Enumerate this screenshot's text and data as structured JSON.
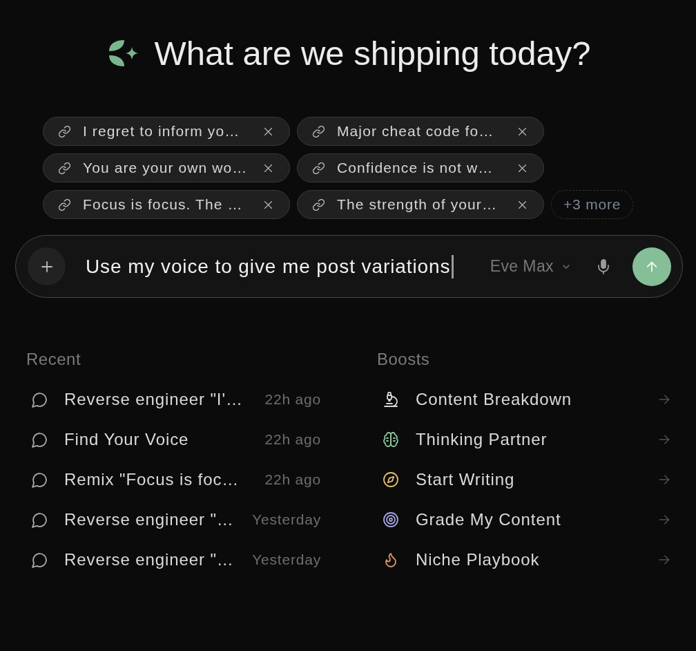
{
  "header": {
    "title": "What are we shipping today?"
  },
  "attachments": {
    "items": [
      {
        "label": "I regret to inform yo…"
      },
      {
        "label": "Major cheat code fo…"
      },
      {
        "label": "You are your own wo…"
      },
      {
        "label": "Confidence is not w…"
      },
      {
        "label": "Focus is focus. The …"
      },
      {
        "label": "The strength of your…"
      }
    ],
    "more": "+3 more"
  },
  "composer": {
    "value": "Use my voice to give me post variations",
    "model": "Eve Max"
  },
  "recent": {
    "heading": "Recent",
    "items": [
      {
        "title": "Reverse engineer \"I'…",
        "time": "22h ago"
      },
      {
        "title": "Find Your Voice",
        "time": "22h ago"
      },
      {
        "title": "Remix \"Focus is foc…",
        "time": "22h ago"
      },
      {
        "title": "Reverse engineer \"…",
        "time": "Yesterday"
      },
      {
        "title": "Reverse engineer \"…",
        "time": "Yesterday"
      }
    ]
  },
  "boosts": {
    "heading": "Boosts",
    "items": [
      {
        "label": "Content Breakdown",
        "color": "#d6d6d6"
      },
      {
        "label": "Thinking Partner",
        "color": "#8ec9a0"
      },
      {
        "label": "Start Writing",
        "color": "#e5bf6a"
      },
      {
        "label": "Grade My Content",
        "color": "#a5a6e3"
      },
      {
        "label": "Niche Playbook",
        "color": "#e3936b"
      }
    ]
  }
}
